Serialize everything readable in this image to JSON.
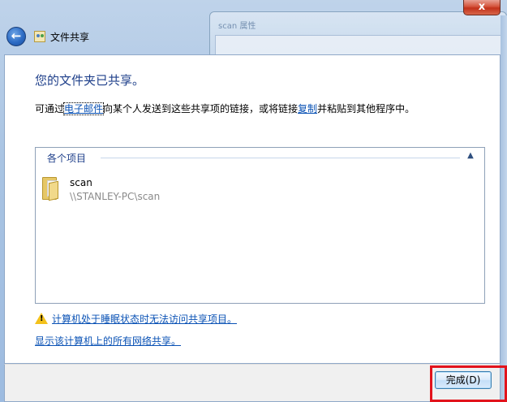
{
  "window": {
    "title": "文件共享",
    "close_label": "x"
  },
  "background_window": {
    "title": "scan 属性"
  },
  "content": {
    "heading": "您的文件夹已共享。",
    "desc_prefix": "可通过",
    "email_link": "电子邮件",
    "desc_middle": "向某个人发送到这些共享项的链接，或将链接",
    "copy_link": "复制",
    "desc_suffix": "并粘贴到其他程序中。"
  },
  "list": {
    "group_label": "各个项目",
    "items": [
      {
        "name": "scan",
        "path": "\\\\STANLEY-PC\\scan"
      }
    ]
  },
  "links": {
    "sleep_warning": "计算机处于睡眠状态时无法访问共享项目。",
    "show_all_shares": "显示该计算机上的所有网络共享。"
  },
  "footer": {
    "done_label": "完成(D)"
  },
  "colors": {
    "heading": "#1e3f8a",
    "link": "#0a52b5",
    "highlight": "#e2131c"
  }
}
